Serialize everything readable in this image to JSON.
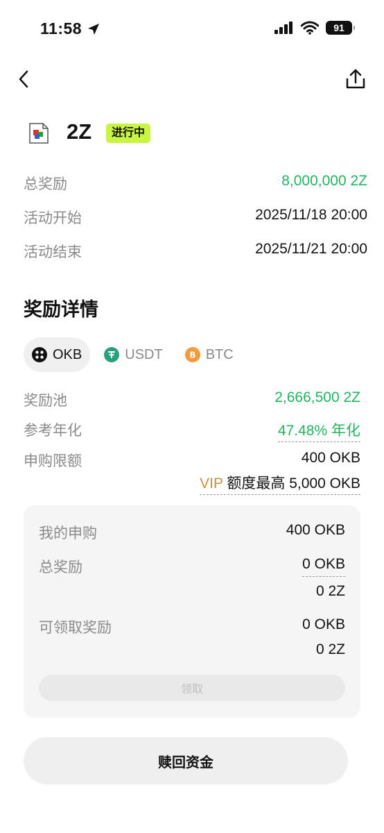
{
  "status_bar": {
    "time": "11:58",
    "battery": "91"
  },
  "token": {
    "name": "2Z",
    "status": "进行中"
  },
  "summary": [
    {
      "label": "总奖励",
      "value": "8,000,000 2Z"
    },
    {
      "label": "活动开始",
      "value": "2025/11/18 20:00"
    },
    {
      "label": "活动结束",
      "value": "2025/11/21 20:00"
    }
  ],
  "details": {
    "title": "奖励详情",
    "tabs": [
      "OKB",
      "USDT",
      "BTC"
    ],
    "pool_label": "奖励池",
    "pool_value": "2,666,500 2Z",
    "apr_label": "参考年化",
    "apr_value": "47.48% 年化",
    "limit_label": "申购限额",
    "limit_value": "400 OKB",
    "vip_prefix": "VIP",
    "vip_text": " 额度最高 5,000 OKB"
  },
  "card": {
    "my_sub_label": "我的申购",
    "my_sub_value": "400 OKB",
    "total_label": "总奖励",
    "total_okb": "0 OKB",
    "total_2z": "0 2Z",
    "claimable_label": "可领取奖励",
    "claimable_okb": "0 OKB",
    "claimable_2z": "0 2Z",
    "claim_button": "领取"
  },
  "redeem_button": "赎回资金"
}
